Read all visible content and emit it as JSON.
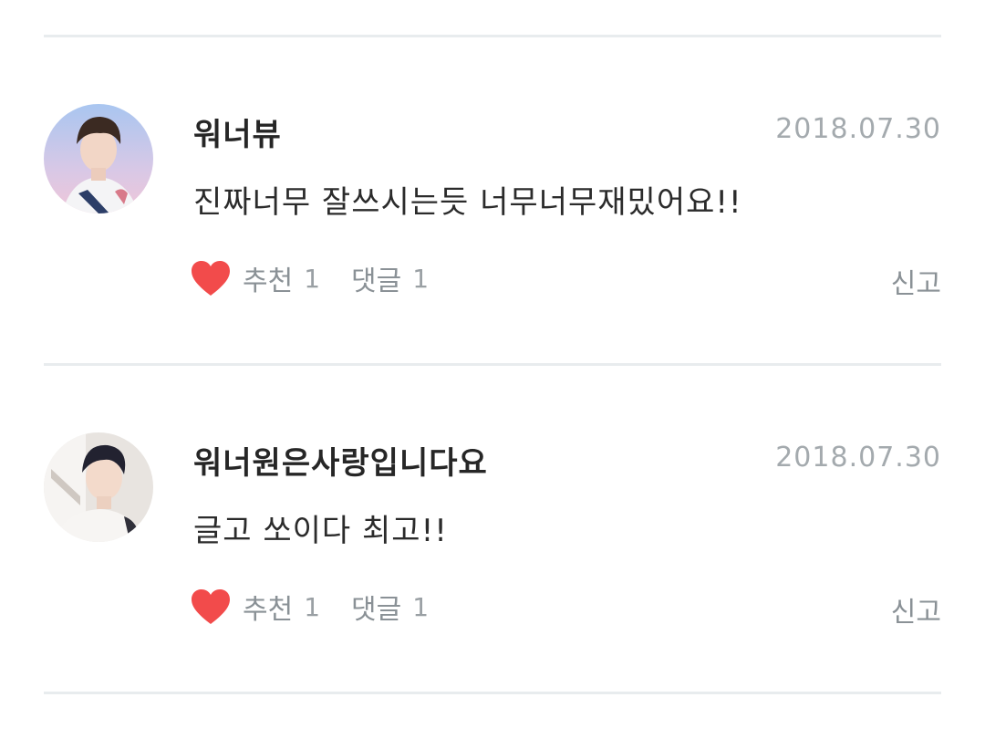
{
  "comments": [
    {
      "nickname": "워너뷰",
      "date": "2018.07.30",
      "text": "진짜너무 잘쓰시는듯 너무너무재밌어요!!",
      "like_label": "추천",
      "like_count": "1",
      "reply_label": "댓글",
      "reply_count": "1",
      "report_label": "신고",
      "avatar_icon": "profile-photo-1"
    },
    {
      "nickname": "워너원은사랑입니다요",
      "date": "2018.07.30",
      "text": "글고 쏘이다 최고!!",
      "like_label": "추천",
      "like_count": "1",
      "reply_label": "댓글",
      "reply_count": "1",
      "report_label": "신고",
      "avatar_icon": "profile-photo-2"
    }
  ],
  "colors": {
    "heart": "#f24b4b",
    "divider": "#e8ecee",
    "meta_text": "#a4aaae"
  },
  "icons": {
    "like": "heart-icon"
  }
}
